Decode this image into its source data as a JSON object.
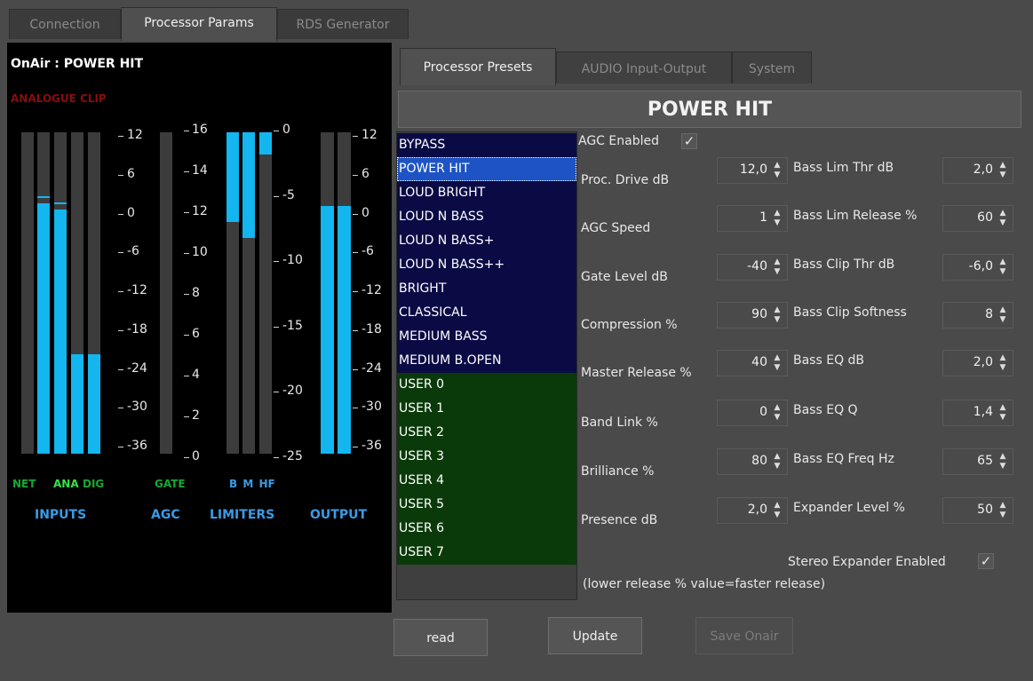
{
  "top_tabs": [
    "Connection",
    "Processor Params",
    "RDS Generator"
  ],
  "meter": {
    "on_air": "OnAir : POWER HIT",
    "analogue_clip": "ANALOGUE CLIP",
    "inputs_scale": [
      "12",
      "6",
      "0",
      "-6",
      "-12",
      "-18",
      "-24",
      "-30",
      "-36"
    ],
    "agc_scale": [
      "16",
      "14",
      "12",
      "10",
      "8",
      "6",
      "4",
      "2",
      "0"
    ],
    "limiter_scale": [
      "0",
      "-5",
      "-10",
      "-15",
      "-20",
      "-25"
    ],
    "output_scale": [
      "12",
      "6",
      "0",
      "-6",
      "-12",
      "-18",
      "-24",
      "-30",
      "-36"
    ],
    "input_labels": {
      "net": "NET",
      "ana": "ANA",
      "dig": "DIG"
    },
    "gate_label": "GATE",
    "limiter_labels": "B M HF",
    "sections": {
      "inputs": "INPUTS",
      "agc": "AGC",
      "limiters": "LIMITERS",
      "output": "OUTPUT"
    },
    "levels": {
      "input_bars": [
        0.0,
        0.78,
        0.76,
        0.31,
        0.31
      ],
      "limiter_bars": [
        0.72,
        0.67,
        0.93
      ],
      "output_bars": [
        0.77,
        0.77
      ]
    },
    "colors": {
      "bar": "#13b6ee",
      "net": "#15a834",
      "ana": "#39e04b",
      "dig": "#15a834",
      "section": "#3a9be6",
      "clip": "#8a0d0d"
    }
  },
  "sub_tabs": [
    "Processor Presets",
    "AUDIO Input-Output",
    "System"
  ],
  "preset_title": "POWER HIT",
  "presets": [
    "BYPASS",
    "POWER HIT",
    "LOUD BRIGHT",
    "LOUD N BASS",
    "LOUD N BASS+",
    "LOUD N BASS++",
    "BRIGHT",
    "CLASSICAL",
    "MEDIUM BASS",
    "MEDIUM B.OPEN",
    "USER 0",
    "USER 1",
    "USER 2",
    "USER 3",
    "USER 4",
    "USER 5",
    "USER 6",
    "USER 7"
  ],
  "selected_preset": "POWER HIT",
  "agc_enabled_label": "AGC Enabled",
  "agc_enabled": true,
  "check_glyph": "✓",
  "params_left": [
    {
      "label": "Proc. Drive dB",
      "value": "12,0"
    },
    {
      "label": "AGC Speed",
      "value": "1"
    },
    {
      "label": "Gate Level dB",
      "value": "-40"
    },
    {
      "label": "Compression %",
      "value": "90"
    },
    {
      "label": "Master Release %",
      "value": "40"
    },
    {
      "label": "Band Link %",
      "value": "0"
    },
    {
      "label": "Brilliance %",
      "value": "80"
    },
    {
      "label": "Presence dB",
      "value": "2,0"
    }
  ],
  "params_right": [
    {
      "label": "Bass Lim Thr dB",
      "value": "2,0"
    },
    {
      "label": "Bass Lim Release %",
      "value": "60"
    },
    {
      "label": "Bass Clip Thr dB",
      "value": "-6,0"
    },
    {
      "label": "Bass Clip Softness",
      "value": "8"
    },
    {
      "label": "Bass EQ dB",
      "value": "2,0"
    },
    {
      "label": "Bass EQ Q",
      "value": "1,4"
    },
    {
      "label": "Bass EQ Freq Hz",
      "value": "65"
    },
    {
      "label": "Expander Level %",
      "value": "50"
    }
  ],
  "stereo_expander_label": "Stereo Expander Enabled",
  "stereo_expander_enabled": true,
  "release_note": "(lower release % value=faster release)",
  "buttons": {
    "read": "read",
    "update": "Update",
    "save": "Save Onair"
  }
}
